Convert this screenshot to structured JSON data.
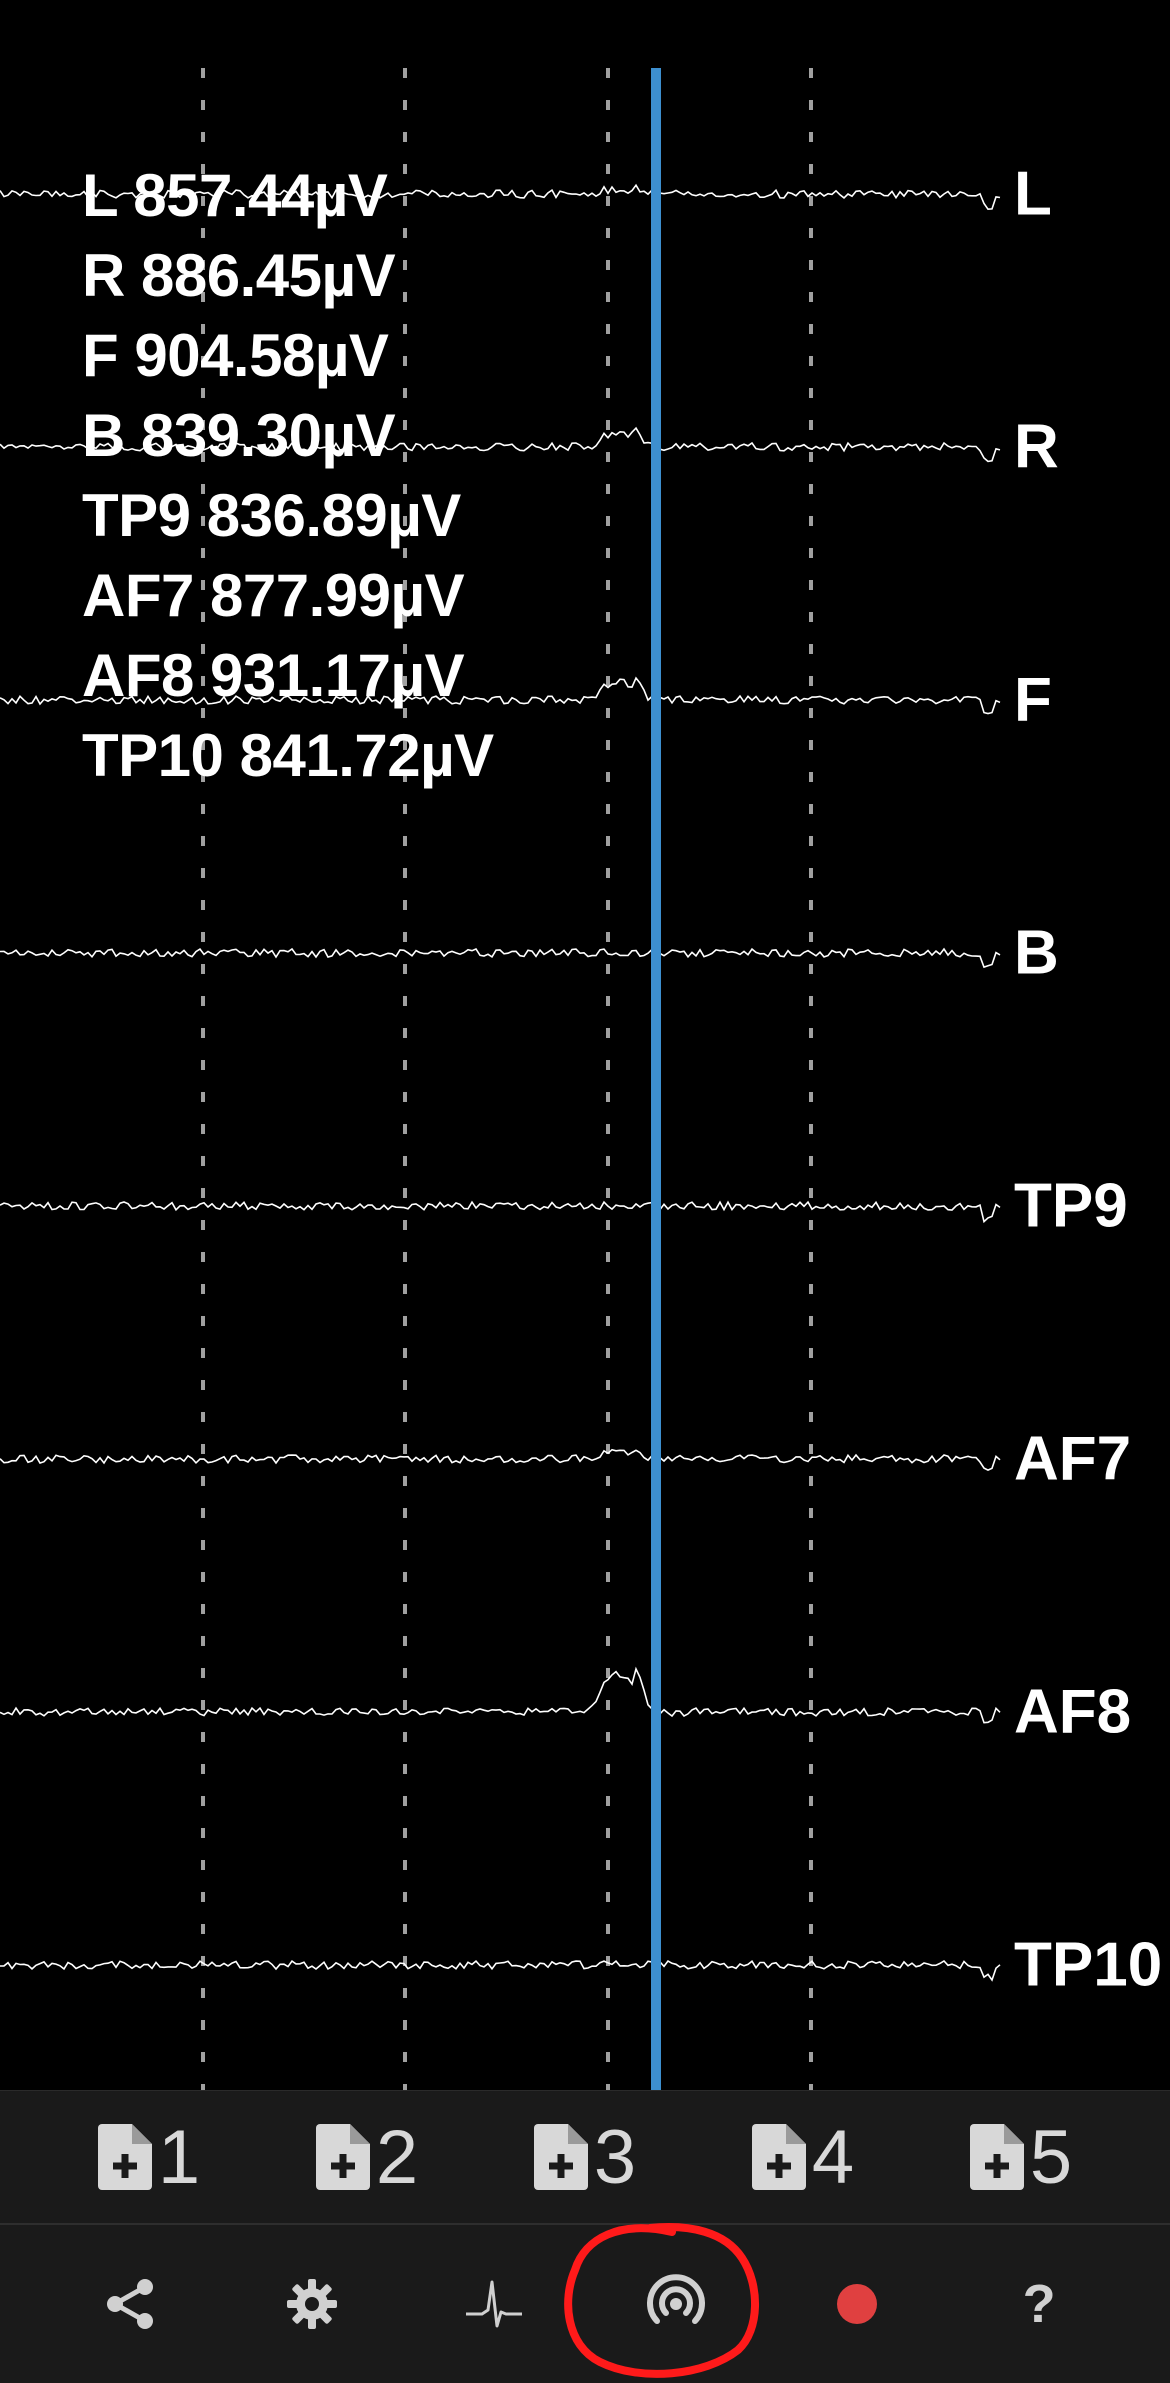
{
  "readout": [
    {
      "channel": "L",
      "value": "857.44µV"
    },
    {
      "channel": "R",
      "value": "886.45µV"
    },
    {
      "channel": "F",
      "value": "904.58µV"
    },
    {
      "channel": "B",
      "value": "839.30µV"
    },
    {
      "channel": "TP9",
      "value": "836.89µV"
    },
    {
      "channel": "AF7",
      "value": "877.99µV"
    },
    {
      "channel": "AF8",
      "value": "931.17µV"
    },
    {
      "channel": "TP10",
      "value": "841.72µV"
    }
  ],
  "channels": [
    "L",
    "R",
    "F",
    "B",
    "TP9",
    "AF7",
    "AF8",
    "TP10"
  ],
  "file_buttons": [
    "1",
    "2",
    "3",
    "4",
    "5"
  ],
  "toolbar": {
    "items": [
      "share-icon",
      "gear-icon",
      "waveform-icon",
      "streaming-icon",
      "record-icon",
      "help-icon"
    ],
    "help_label": "?"
  },
  "colors": {
    "background": "#000000",
    "trace": "#ffffff",
    "cursor": "#3d8fcf",
    "gridline": "#a0a0a0",
    "record": "#e04040",
    "annotation": "#ff1a1a",
    "bar": "#1a1a1a"
  }
}
